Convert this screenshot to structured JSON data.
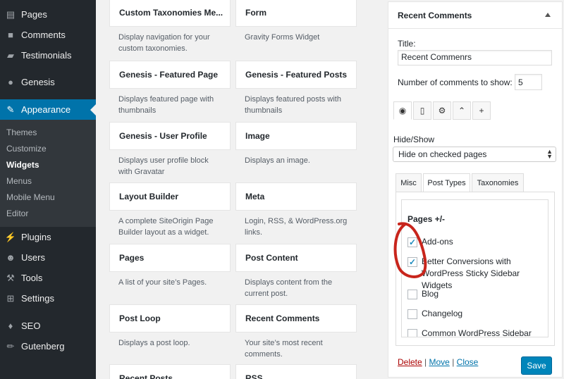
{
  "sidebar": {
    "items": [
      {
        "label": "Pages",
        "icon": "pages-icon"
      },
      {
        "label": "Comments",
        "icon": "comments-icon"
      },
      {
        "label": "Testimonials",
        "icon": "testimonials-icon"
      },
      {
        "label": "Genesis",
        "icon": "genesis-icon"
      },
      {
        "label": "Appearance",
        "icon": "appearance-icon"
      },
      {
        "label": "Plugins",
        "icon": "plugins-icon"
      },
      {
        "label": "Users",
        "icon": "users-icon"
      },
      {
        "label": "Tools",
        "icon": "tools-icon"
      },
      {
        "label": "Settings",
        "icon": "settings-icon"
      },
      {
        "label": "SEO",
        "icon": "seo-icon"
      },
      {
        "label": "Gutenberg",
        "icon": "gutenberg-icon"
      }
    ],
    "submenu": [
      "Themes",
      "Customize",
      "Widgets",
      "Menus",
      "Mobile Menu",
      "Editor"
    ],
    "active_color": "#0073aa"
  },
  "widgets": [
    {
      "title": "Custom Taxonomies Me...",
      "desc": "Display navigation for your custom taxonomies."
    },
    {
      "title": "Form",
      "desc": "Gravity Forms Widget"
    },
    {
      "title": "Genesis - Featured Page",
      "desc": "Displays featured page with thumbnails"
    },
    {
      "title": "Genesis - Featured Posts",
      "desc": "Displays featured posts with thumbnails"
    },
    {
      "title": "Genesis - User Profile",
      "desc": "Displays user profile block with Gravatar"
    },
    {
      "title": "Image",
      "desc": "Displays an image."
    },
    {
      "title": "Layout Builder",
      "desc": "A complete SiteOrigin Page Builder layout as a widget."
    },
    {
      "title": "Meta",
      "desc": "Login, RSS, & WordPress.org links."
    },
    {
      "title": "Pages",
      "desc": "A list of your site’s Pages."
    },
    {
      "title": "Post Content",
      "desc": "Displays content from the current post."
    },
    {
      "title": "Post Loop",
      "desc": "Displays a post loop."
    },
    {
      "title": "Recent Comments",
      "desc": "Your site’s most recent comments."
    },
    {
      "title": "Recent Posts",
      "desc": ""
    },
    {
      "title": "RSS",
      "desc": ""
    }
  ],
  "panel": {
    "header": "Recent Comments",
    "title_label": "Title:",
    "title_value": "Recent Commenrs",
    "count_label": "Number of comments to show:",
    "count_value": "5",
    "icon_tabs": [
      "eye-icon",
      "mobile-icon",
      "gear-icon",
      "chevron-up-icon",
      "plus-icon"
    ],
    "hide_show_label": "Hide/Show",
    "hide_show_value": "Hide on checked pages",
    "sub_tabs": [
      "Misc",
      "Post Types",
      "Taxonomies"
    ],
    "list_heading": "Pages +/-",
    "pages": [
      {
        "label": "Add-ons",
        "checked": true
      },
      {
        "label": "Better Conversions with WordPress Sticky Sidebar Widgets",
        "checked": true
      },
      {
        "label": "Blog",
        "checked": false
      },
      {
        "label": "Changelog",
        "checked": false
      },
      {
        "label": "Common WordPress Sidebar",
        "checked": false
      }
    ],
    "link_delete": "Delete",
    "link_move": "Move",
    "link_close": "Close",
    "separator": "|",
    "save_label": "Save",
    "save_color": "#0085ba"
  }
}
